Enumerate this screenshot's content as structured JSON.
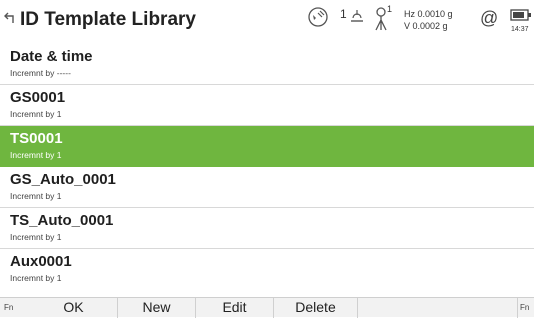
{
  "header": {
    "title": "ID Template Library",
    "status": {
      "target_number": "1",
      "prism_number": "1",
      "hz": "Hz 0.0010 g",
      "v": "V 0.0002 g",
      "time": "14:37",
      "at_symbol": "@"
    }
  },
  "list": {
    "items": [
      {
        "name": "Date & time",
        "sub": "Incremnt by -----",
        "selected": false
      },
      {
        "name": "GS0001",
        "sub": "Incremnt by 1",
        "selected": false
      },
      {
        "name": "TS0001",
        "sub": "Incremnt by 1",
        "selected": true
      },
      {
        "name": "GS_Auto_0001",
        "sub": "Incremnt by 1",
        "selected": false
      },
      {
        "name": "TS_Auto_0001",
        "sub": "Incremnt by 1",
        "selected": false
      },
      {
        "name": "Aux0001",
        "sub": "Incremnt by 1",
        "selected": false
      }
    ]
  },
  "toolbar": {
    "fn_left": "Fn",
    "ok": "OK",
    "new": "New",
    "edit": "Edit",
    "delete": "Delete",
    "fn_right": "Fn"
  },
  "colors": {
    "selection": "#6fb63f"
  },
  "icons": {
    "back": "back-arrow-icon",
    "satellite": "satellite-icon",
    "target": "target-icon",
    "prism": "prism-icon",
    "at": "at-icon",
    "battery": "battery-icon"
  }
}
